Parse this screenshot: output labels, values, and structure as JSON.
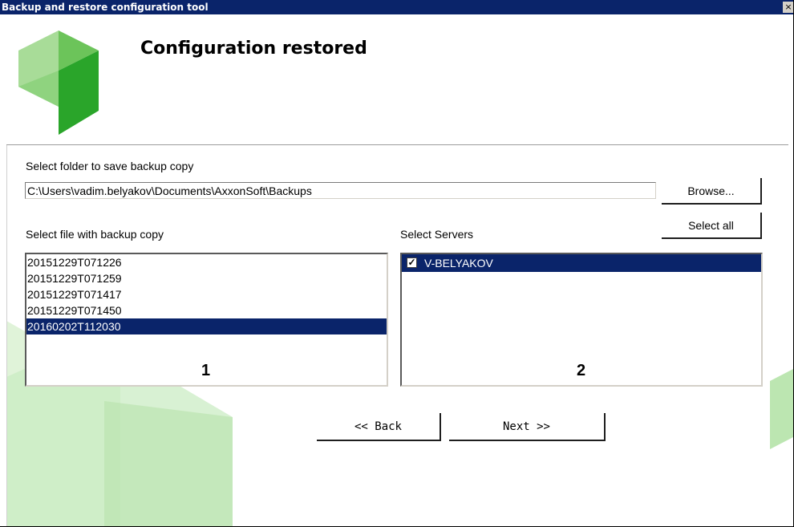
{
  "window": {
    "title": "Backup and restore configuration tool",
    "close_glyph": "×"
  },
  "header": {
    "title": "Configuration restored",
    "logo_icon": "cube-logo-icon"
  },
  "backup_folder": {
    "label": "Select folder to save backup copy",
    "value": "C:\\Users\\vadim.belyakov\\Documents\\AxxonSoft\\Backups",
    "browse_label": "Browse..."
  },
  "files": {
    "label": "Select file with backup copy",
    "items": [
      {
        "name": "20151229T071226",
        "selected": false
      },
      {
        "name": "20151229T071259",
        "selected": false
      },
      {
        "name": "20151229T071417",
        "selected": false
      },
      {
        "name": "20151229T071450",
        "selected": false
      },
      {
        "name": "20160202T112030",
        "selected": true
      }
    ],
    "marker": "1"
  },
  "servers": {
    "label": "Select Servers",
    "select_all_label": "Select all",
    "items": [
      {
        "name": "V-BELYAKOV",
        "checked": true,
        "selected": true
      }
    ],
    "marker": "2"
  },
  "navigation": {
    "back_label": "<< Back",
    "next_label": "Next >>"
  },
  "colors": {
    "title_bar": "#0a246a",
    "selection": "#0a246a",
    "logo_light": "#8fd37f",
    "logo_dark": "#2aa52a"
  }
}
